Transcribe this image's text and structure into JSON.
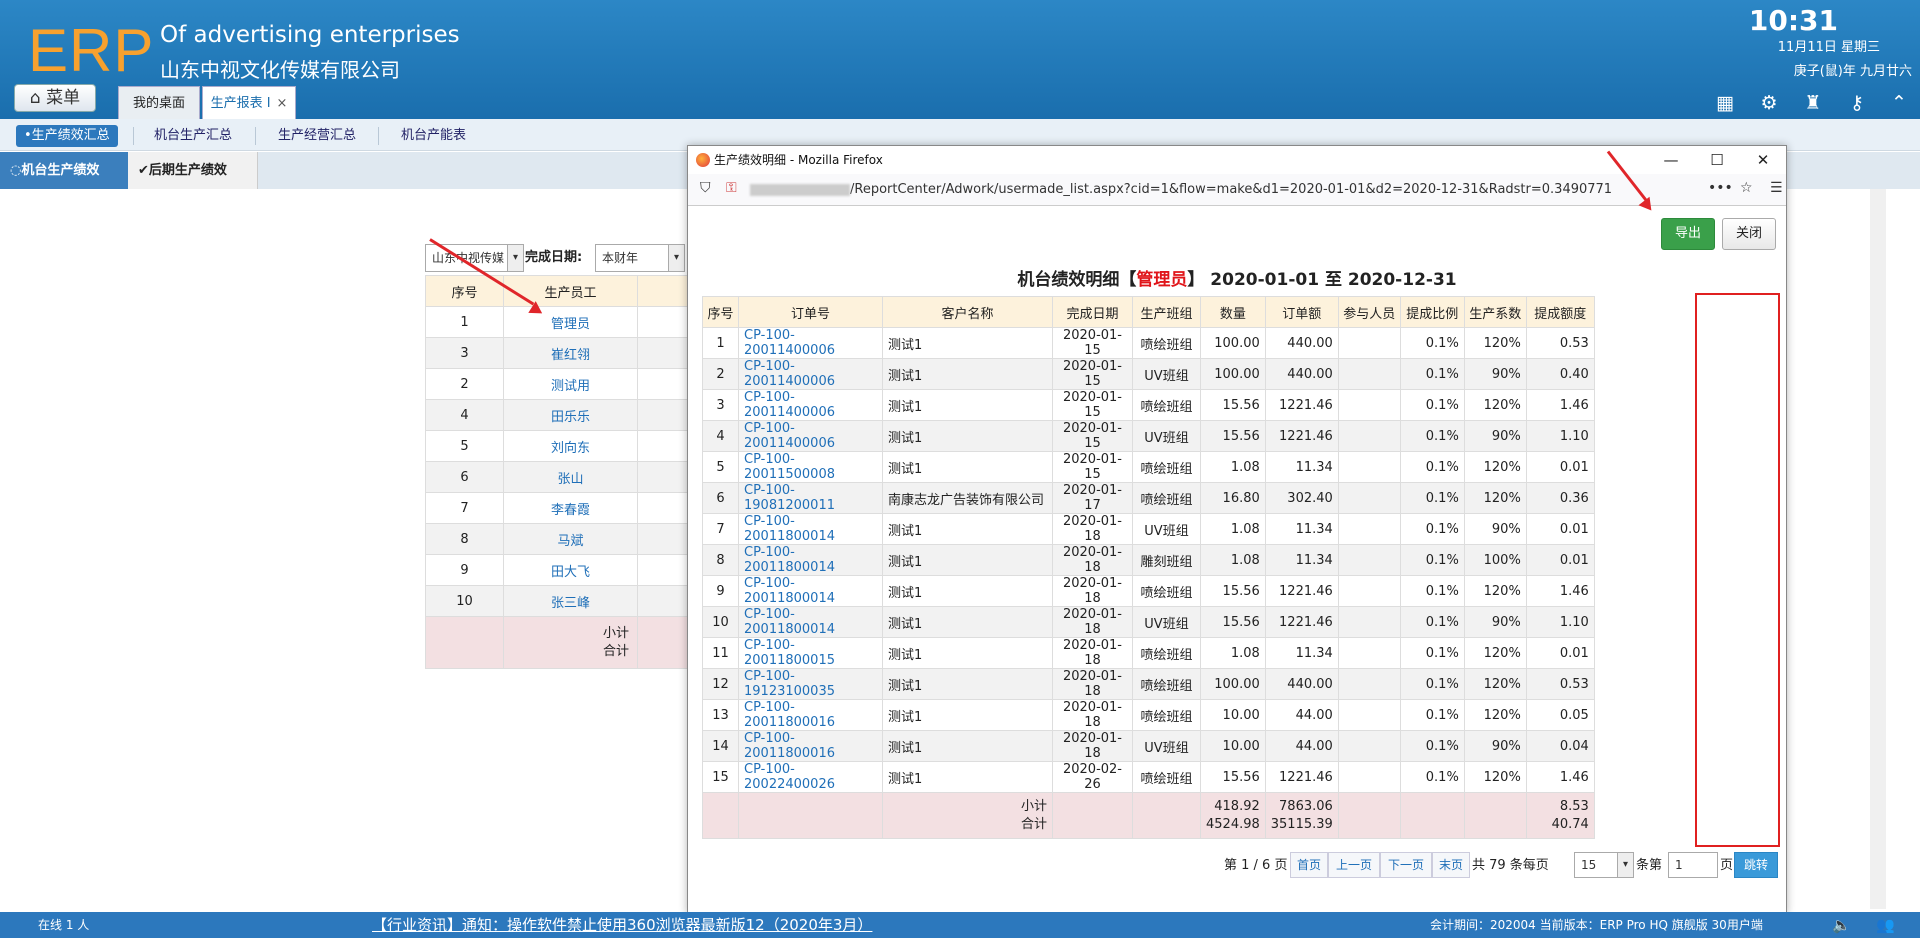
{
  "header": {
    "logo": "ERP",
    "company_en": "Of advertising enterprises",
    "company_cn": "山东中视文化传媒有限公司",
    "time": "10:31",
    "date": "11月11日 星期三",
    "lunar": "庚子(鼠)年 九月廿六"
  },
  "toolbar": {
    "menu_label": "菜单",
    "tabs": [
      {
        "label": "我的桌面"
      },
      {
        "label": "生产报表 I"
      }
    ],
    "close": "×",
    "tab_close": "×"
  },
  "subnav": [
    "•生产绩效汇总",
    "机台生产汇总",
    "生产经营汇总",
    "机台产能表"
  ],
  "subtabs": [
    "机台生产绩效",
    "后期生产绩效"
  ],
  "filter": {
    "company": "山东中视传媒",
    "date_label": "完成日期:",
    "date_value": "本财年"
  },
  "bg_table": {
    "headers": [
      "序号",
      "生产员工"
    ],
    "rows": [
      [
        "1",
        "管理员"
      ],
      [
        "3",
        "崔红翎"
      ],
      [
        "2",
        "测试用"
      ],
      [
        "4",
        "田乐乐"
      ],
      [
        "5",
        "刘向东"
      ],
      [
        "6",
        "张山"
      ],
      [
        "7",
        "李春霞"
      ],
      [
        "8",
        "马斌"
      ],
      [
        "9",
        "田大飞"
      ],
      [
        "10",
        "张三峰"
      ]
    ],
    "subtotal": "小计",
    "total": "合计"
  },
  "popup": {
    "title": "生产绩效明细 - Mozilla Firefox",
    "url": "/ReportCenter/Adwork/usermade_list.aspx?cid=1&flow=make&d1=2020-01-01&d2=2020-12-31&Radstr=0.3490771",
    "export_label": "导出",
    "close_label": "关闭",
    "report_title_pre": "机台绩效明细【",
    "report_title_user": "管理员",
    "report_title_post": "】 2020-01-01 至 2020-12-31",
    "headers": [
      "序号",
      "订单号",
      "客户名称",
      "完成日期",
      "生产班组",
      "数量",
      "订单额",
      "参与人员",
      "提成比例",
      "生产系数",
      "提成额度"
    ],
    "rows": [
      [
        "1",
        "CP-100-20011400006",
        "测试1",
        "2020-01-15",
        "喷绘班组",
        "100.00",
        "440.00",
        "",
        "0.1%",
        "120%",
        "0.53"
      ],
      [
        "2",
        "CP-100-20011400006",
        "测试1",
        "2020-01-15",
        "UV班组",
        "100.00",
        "440.00",
        "",
        "0.1%",
        "90%",
        "0.40"
      ],
      [
        "3",
        "CP-100-20011400006",
        "测试1",
        "2020-01-15",
        "喷绘班组",
        "15.56",
        "1221.46",
        "",
        "0.1%",
        "120%",
        "1.46"
      ],
      [
        "4",
        "CP-100-20011400006",
        "测试1",
        "2020-01-15",
        "UV班组",
        "15.56",
        "1221.46",
        "",
        "0.1%",
        "90%",
        "1.10"
      ],
      [
        "5",
        "CP-100-20011500008",
        "测试1",
        "2020-01-15",
        "喷绘班组",
        "1.08",
        "11.34",
        "",
        "0.1%",
        "120%",
        "0.01"
      ],
      [
        "6",
        "CP-100-19081200011",
        "南康志龙广告装饰有限公司",
        "2020-01-17",
        "喷绘班组",
        "16.80",
        "302.40",
        "",
        "0.1%",
        "120%",
        "0.36"
      ],
      [
        "7",
        "CP-100-20011800014",
        "测试1",
        "2020-01-18",
        "UV班组",
        "1.08",
        "11.34",
        "",
        "0.1%",
        "90%",
        "0.01"
      ],
      [
        "8",
        "CP-100-20011800014",
        "测试1",
        "2020-01-18",
        "雕刻班组",
        "1.08",
        "11.34",
        "",
        "0.1%",
        "100%",
        "0.01"
      ],
      [
        "9",
        "CP-100-20011800014",
        "测试1",
        "2020-01-18",
        "喷绘班组",
        "15.56",
        "1221.46",
        "",
        "0.1%",
        "120%",
        "1.46"
      ],
      [
        "10",
        "CP-100-20011800014",
        "测试1",
        "2020-01-18",
        "UV班组",
        "15.56",
        "1221.46",
        "",
        "0.1%",
        "90%",
        "1.10"
      ],
      [
        "11",
        "CP-100-20011800015",
        "测试1",
        "2020-01-18",
        "喷绘班组",
        "1.08",
        "11.34",
        "",
        "0.1%",
        "120%",
        "0.01"
      ],
      [
        "12",
        "CP-100-19123100035",
        "测试1",
        "2020-01-18",
        "喷绘班组",
        "100.00",
        "440.00",
        "",
        "0.1%",
        "120%",
        "0.53"
      ],
      [
        "13",
        "CP-100-20011800016",
        "测试1",
        "2020-01-18",
        "喷绘班组",
        "10.00",
        "44.00",
        "",
        "0.1%",
        "120%",
        "0.05"
      ],
      [
        "14",
        "CP-100-20011800016",
        "测试1",
        "2020-01-18",
        "UV班组",
        "10.00",
        "44.00",
        "",
        "0.1%",
        "90%",
        "0.04"
      ],
      [
        "15",
        "CP-100-20022400026",
        "测试1",
        "2020-02-26",
        "喷绘班组",
        "15.56",
        "1221.46",
        "",
        "0.1%",
        "120%",
        "1.46"
      ]
    ],
    "subtotal": {
      "label": "小计",
      "qty": "418.92",
      "amount": "7863.06",
      "comm": "8.53"
    },
    "total": {
      "label": "合计",
      "qty": "4524.98",
      "amount": "35115.39",
      "comm": "40.74"
    },
    "pager": {
      "page_info": "第 1 / 6 页",
      "first": "首页",
      "prev": "上一页",
      "next": "下一页",
      "last": "末页",
      "total_info": "共 79 条每页",
      "per_page": "15",
      "goto_pre": "条第",
      "goto_val": "1",
      "goto_post": "页",
      "goto_btn": "跳转"
    }
  },
  "footer": {
    "online": "在线  1  人",
    "notice": "【行业资讯】通知：操作软件禁止使用360浏览器最新版12（2020年3月）",
    "version": "会计期间：202004 当前版本：ERP Pro HQ 旗舰版 30用户端"
  }
}
